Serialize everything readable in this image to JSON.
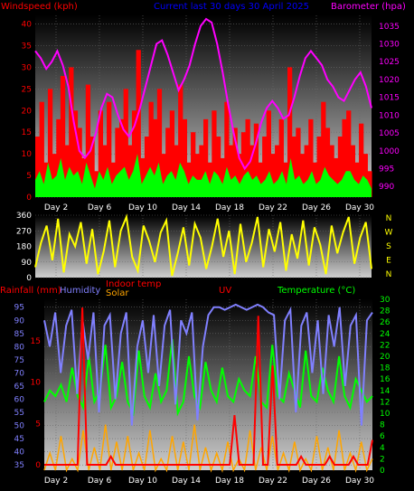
{
  "chart_data": [
    {
      "type": "line",
      "title": "Current last 30 days 30 April 2025",
      "left_label": "Windspeed (kph)",
      "right_label": "Barometer (hpa)",
      "x_ticks": [
        "Day 2",
        "Day 6",
        "Day 10",
        "Day 14",
        "Day 18",
        "Day 22",
        "Day 26",
        "Day 30"
      ],
      "y_left_ticks": [
        "0",
        "5",
        "10",
        "15",
        "20",
        "25",
        "30",
        "35",
        "40"
      ],
      "y_right_ticks": [
        "990",
        "995",
        "1000",
        "1005",
        "1010",
        "1015",
        "1020",
        "1025",
        "1030",
        "1035"
      ],
      "ylim_left": [
        0,
        42
      ],
      "ylim_right": [
        987,
        1038
      ],
      "colors": {
        "gust": "#ff0000",
        "avg_wind": "#00ff00",
        "barometer": "#ff00ff",
        "left_label": "#ff0000",
        "title": "#0000ff",
        "right_label": "#ff00ff"
      },
      "series": [
        {
          "key": "gust",
          "color": "#ff0000",
          "values": [
            14,
            22,
            8,
            25,
            10,
            18,
            28,
            12,
            30,
            20,
            16,
            9,
            26,
            14,
            6,
            20,
            12,
            22,
            8,
            16,
            18,
            25,
            12,
            20,
            34,
            9,
            14,
            22,
            18,
            25,
            10,
            16,
            20,
            12,
            26,
            18,
            8,
            15,
            10,
            12,
            18,
            8,
            20,
            14,
            9,
            22,
            12,
            16,
            10,
            15,
            18,
            12,
            17,
            8,
            14,
            20,
            10,
            12,
            18,
            8,
            30,
            14,
            16,
            10,
            12,
            18,
            8,
            14,
            22,
            16,
            12,
            9,
            14,
            18,
            20,
            12,
            8,
            17,
            10,
            6
          ]
        },
        {
          "key": "avg_wind",
          "color": "#00ff00",
          "values": [
            4,
            6,
            3,
            8,
            4,
            5,
            9,
            4,
            7,
            5,
            6,
            3,
            8,
            5,
            2,
            6,
            4,
            7,
            3,
            5,
            6,
            7,
            4,
            6,
            10,
            3,
            5,
            7,
            5,
            8,
            3,
            5,
            6,
            4,
            8,
            6,
            3,
            5,
            4,
            4,
            6,
            3,
            6,
            5,
            3,
            7,
            4,
            5,
            3,
            5,
            6,
            4,
            5,
            3,
            4,
            6,
            3,
            4,
            6,
            3,
            9,
            4,
            5,
            3,
            4,
            6,
            3,
            4,
            7,
            5,
            4,
            3,
            4,
            6,
            6,
            4,
            3,
            5,
            4,
            2
          ]
        },
        {
          "key": "barometer",
          "color": "#ff00ff",
          "values": [
            1028,
            1026,
            1023,
            1025,
            1028,
            1024,
            1018,
            1008,
            1000,
            998,
            1000,
            1005,
            1012,
            1016,
            1015,
            1010,
            1006,
            1004,
            1007,
            1012,
            1018,
            1024,
            1030,
            1031,
            1027,
            1022,
            1017,
            1020,
            1024,
            1030,
            1035,
            1037,
            1036,
            1030,
            1022,
            1013,
            1005,
            998,
            995,
            997,
            1002,
            1008,
            1012,
            1014,
            1012,
            1009,
            1010,
            1015,
            1021,
            1026,
            1028,
            1026,
            1024,
            1020,
            1018,
            1015,
            1014,
            1017,
            1020,
            1022,
            1018,
            1012
          ]
        }
      ]
    },
    {
      "type": "scatter",
      "title": "",
      "x_ticks": [
        "Day 2",
        "Day 6",
        "Day 10",
        "Day 14",
        "Day 18",
        "Day 22",
        "Day 26",
        "Day 30"
      ],
      "y_ticks": [
        "0",
        "90",
        "180",
        "270",
        "360"
      ],
      "compass_labels": [
        "N",
        "W",
        "S",
        "E",
        "N"
      ],
      "ylim": [
        0,
        360
      ],
      "colors": {
        "direction": "#ffff00"
      },
      "series": [
        {
          "key": "wind_direction",
          "color": "#ffff00",
          "values": [
            60,
            200,
            300,
            100,
            340,
            30,
            250,
            180,
            320,
            80,
            280,
            20,
            150,
            330,
            60,
            270,
            350,
            120,
            40,
            300,
            210,
            90,
            260,
            330,
            10,
            140,
            290,
            70,
            310,
            230,
            50,
            180,
            340,
            120,
            270,
            20,
            310,
            90,
            200,
            350,
            60,
            280,
            150,
            320,
            40,
            250,
            110,
            330,
            70,
            290,
            190,
            20,
            300,
            140,
            260,
            350,
            80,
            230,
            320,
            50
          ]
        }
      ]
    },
    {
      "type": "line",
      "title": "",
      "legend": [
        "Rainfall (mm)",
        "Humidity",
        "Indoor temp",
        "Solar",
        "UV",
        "Temperature (°C)"
      ],
      "x_ticks": [
        "Day 2",
        "Day 6",
        "Day 10",
        "Day 14",
        "Day 18",
        "Day 22",
        "Day 26",
        "Day 30"
      ],
      "y_left_ticks": [
        "35",
        "40",
        "45",
        "50",
        "55",
        "60",
        "65",
        "70",
        "75",
        "80",
        "85",
        "90",
        "95"
      ],
      "y_rain_ticks": [
        "0",
        "5",
        "10",
        "15"
      ],
      "y_right_ticks": [
        "0",
        "2",
        "4",
        "6",
        "8",
        "10",
        "12",
        "14",
        "16",
        "18",
        "20",
        "22",
        "24",
        "26",
        "28",
        "30"
      ],
      "ylim_humidity": [
        33,
        98
      ],
      "ylim_rain": [
        0,
        20
      ],
      "ylim_temp": [
        0,
        30
      ],
      "colors": {
        "rainfall": "#ff0000",
        "humidity": "#8080ff",
        "indoor": "#ff0000",
        "solar": "#ffa500",
        "uv": "#ff0000",
        "temperature": "#00ff00"
      },
      "series": [
        {
          "key": "humidity",
          "color": "#8080ff",
          "values": [
            90,
            80,
            93,
            70,
            88,
            94,
            62,
            90,
            75,
            93,
            55,
            88,
            92,
            60,
            85,
            93,
            50,
            80,
            90,
            70,
            92,
            65,
            88,
            94,
            58,
            90,
            85,
            93,
            52,
            80,
            92,
            95,
            95,
            94,
            95,
            96,
            95,
            94,
            95,
            96,
            95,
            93,
            92,
            60,
            90,
            94,
            55,
            88,
            93,
            70,
            90,
            62,
            92,
            80,
            95,
            65,
            88,
            92,
            50,
            90,
            93
          ]
        },
        {
          "key": "temperature",
          "color": "#00ff00",
          "values": [
            12,
            14,
            13,
            15,
            12,
            18,
            13,
            11,
            20,
            12,
            14,
            22,
            11,
            13,
            19,
            12,
            10,
            21,
            13,
            11,
            17,
            12,
            14,
            23,
            10,
            12,
            20,
            13,
            11,
            19,
            14,
            12,
            18,
            13,
            12,
            16,
            14,
            13,
            20,
            12,
            11,
            22,
            13,
            12,
            17,
            14,
            11,
            21,
            13,
            12,
            18,
            14,
            12,
            20,
            13,
            11,
            16,
            14,
            12,
            13
          ]
        },
        {
          "key": "solar",
          "color": "#ffa500",
          "values": [
            0,
            3,
            0,
            6,
            0,
            2,
            0,
            7,
            0,
            4,
            0,
            8,
            0,
            5,
            0,
            6,
            0,
            3,
            0,
            7,
            0,
            2,
            0,
            6,
            0,
            5,
            0,
            8,
            0,
            4,
            0,
            3,
            0,
            5,
            0,
            2,
            0,
            7,
            0,
            4,
            0,
            6,
            0,
            3,
            0,
            5,
            0,
            2,
            0,
            6,
            0,
            4,
            0,
            7,
            0,
            3,
            0,
            5,
            0,
            2
          ]
        },
        {
          "key": "rainfall",
          "color": "#ff0000",
          "values": [
            0,
            0,
            0,
            0,
            0,
            0,
            0,
            0,
            19,
            0,
            0,
            0,
            0,
            0,
            1,
            0,
            0,
            0,
            0,
            0,
            0,
            0,
            0,
            0,
            0,
            0,
            0,
            0,
            0,
            0,
            0,
            0,
            0,
            0,
            0,
            0,
            0,
            0,
            0,
            0,
            6,
            0,
            0,
            0,
            0,
            18,
            0,
            0,
            12,
            0,
            0,
            0,
            0,
            0,
            1,
            0,
            0,
            0,
            0,
            0,
            1,
            0,
            0,
            0,
            0,
            1,
            0,
            0,
            0,
            3
          ]
        }
      ]
    }
  ]
}
